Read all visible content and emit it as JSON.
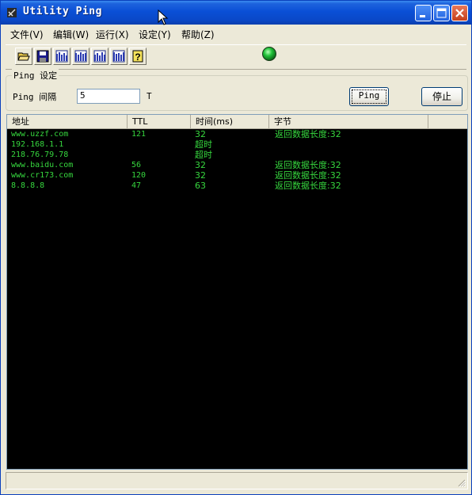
{
  "window": {
    "title": "Utility Ping"
  },
  "menu": [
    {
      "label": "文件(V)"
    },
    {
      "label": "编辑(W)"
    },
    {
      "label": "运行(X)"
    },
    {
      "label": "设定(Y)"
    },
    {
      "label": "帮助(Z)"
    }
  ],
  "toolbar": {
    "icons": [
      "open-folder-icon",
      "save-disk-icon",
      "chart-icon",
      "chart-icon",
      "chart-icon",
      "chart-icon",
      "help-icon"
    ],
    "status_led_color": "#22c33a"
  },
  "settings": {
    "group_title": "Ping 设定",
    "interval_label": "Ping 间隔",
    "interval_value": "5",
    "interval_unit": "T",
    "ping_button": "Ping",
    "stop_button": "停止"
  },
  "table": {
    "headers": [
      "地址",
      "TTL",
      "时间(ms)",
      "字节"
    ],
    "text_color": "#36d63e",
    "background": "#000000",
    "rows": [
      {
        "address": "www.uzzf.com",
        "ttl": "121",
        "time": "32",
        "bytes": "返回数据长度:32"
      },
      {
        "address": "192.168.1.1",
        "ttl": "",
        "time": "超时",
        "bytes": ""
      },
      {
        "address": "218.76.79.78",
        "ttl": "",
        "time": "超时",
        "bytes": ""
      },
      {
        "address": "www.baidu.com",
        "ttl": "56",
        "time": "32",
        "bytes": "返回数据长度:32"
      },
      {
        "address": "www.cr173.com",
        "ttl": "120",
        "time": "32",
        "bytes": "返回数据长度:32"
      },
      {
        "address": "8.8.8.8",
        "ttl": "47",
        "time": "63",
        "bytes": "返回数据长度:32"
      }
    ]
  }
}
